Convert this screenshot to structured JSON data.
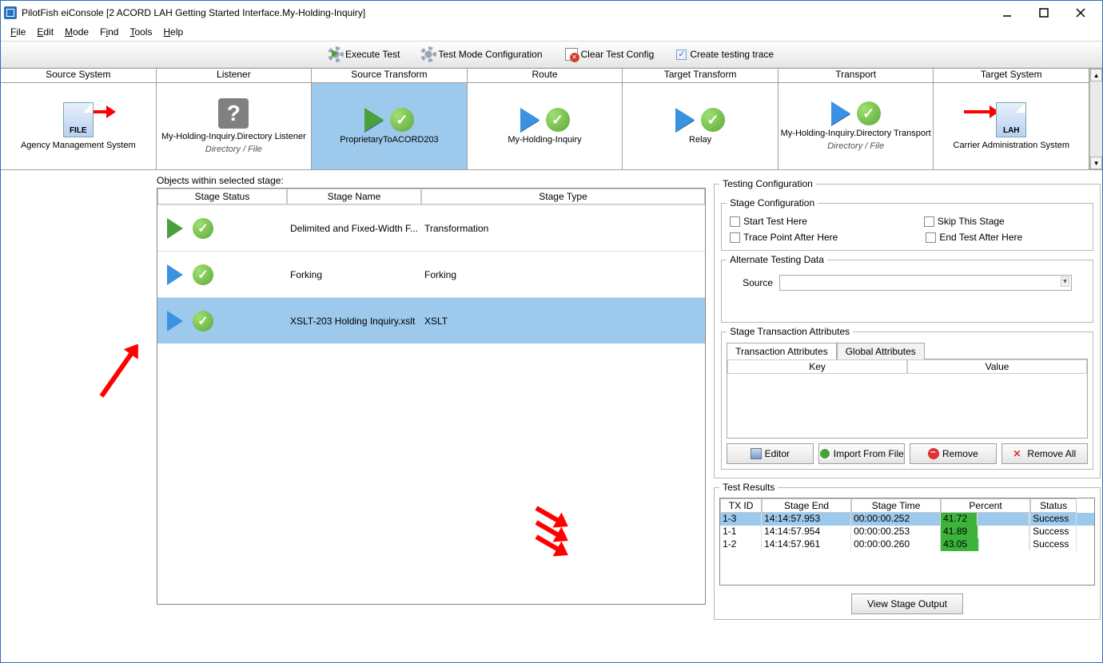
{
  "window": {
    "title": "PilotFish eiConsole [2 ACORD LAH Getting Started Interface.My-Holding-Inquiry]"
  },
  "menu": {
    "file": "File",
    "edit": "Edit",
    "mode": "Mode",
    "find": "Find",
    "tools": "Tools",
    "help": "Help"
  },
  "toolbar": {
    "execute": "Execute Test",
    "config": "Test Mode Configuration",
    "clear": "Clear Test Config",
    "trace": "Create testing trace"
  },
  "stages": {
    "headers": [
      "Source System",
      "Listener",
      "Source Transform",
      "Route",
      "Target Transform",
      "Transport",
      "Target System"
    ],
    "items": [
      {
        "label": "Agency Management System",
        "sub": "",
        "icon": "file",
        "text": "FILE"
      },
      {
        "label": "My-Holding-Inquiry.Directory Listener",
        "sub": "Directory / File",
        "icon": "q"
      },
      {
        "label": "ProprietaryToACORD203",
        "sub": "",
        "icon": "playcheck",
        "green": true,
        "selected": true
      },
      {
        "label": "My-Holding-Inquiry",
        "sub": "",
        "icon": "playcheck"
      },
      {
        "label": "Relay",
        "sub": "",
        "icon": "playcheck"
      },
      {
        "label": "My-Holding-Inquiry.Directory Transport",
        "sub": "Directory / File",
        "icon": "playcheck"
      },
      {
        "label": "Carrier Administration System",
        "sub": "",
        "icon": "file",
        "text": "LAH"
      }
    ]
  },
  "objects": {
    "title": "Objects within selected stage:",
    "cols": [
      "Stage Status",
      "Stage Name",
      "Stage Type"
    ],
    "rows": [
      {
        "green": true,
        "name": "Delimited and Fixed-Width F...",
        "type": "Transformation",
        "sel": false
      },
      {
        "green": false,
        "name": "Forking",
        "type": "Forking",
        "sel": false
      },
      {
        "green": false,
        "name": "XSLT-203 Holding Inquiry.xslt",
        "type": "XSLT",
        "sel": true
      }
    ]
  },
  "testing": {
    "title": "Testing Configuration",
    "stage_cfg": "Stage Configuration",
    "start": "Start Test Here",
    "skip": "Skip This Stage",
    "tp": "Trace Point After Here",
    "end": "End Test After Here",
    "alt": "Alternate Testing Data",
    "source": "Source",
    "sta": "Stage Transaction Attributes",
    "tab1": "Transaction Attributes",
    "tab2": "Global Attributes",
    "key": "Key",
    "value": "Value",
    "editor": "Editor",
    "import": "Import From File",
    "remove": "Remove",
    "removeall": "Remove All"
  },
  "results": {
    "title": "Test Results",
    "cols": [
      "TX ID",
      "Stage End",
      "Stage Time",
      "Percent",
      "Status"
    ],
    "rows": [
      {
        "id": "1-3",
        "end": "14:14:57.953",
        "time": "00:00:00.252",
        "pct": "41.72",
        "status": "Success",
        "sel": true
      },
      {
        "id": "1-1",
        "end": "14:14:57.954",
        "time": "00:00:00.253",
        "pct": "41.89",
        "status": "Success",
        "sel": false
      },
      {
        "id": "1-2",
        "end": "14:14:57.961",
        "time": "00:00:00.260",
        "pct": "43.05",
        "status": "Success",
        "sel": false
      }
    ],
    "view": "View Stage Output"
  }
}
